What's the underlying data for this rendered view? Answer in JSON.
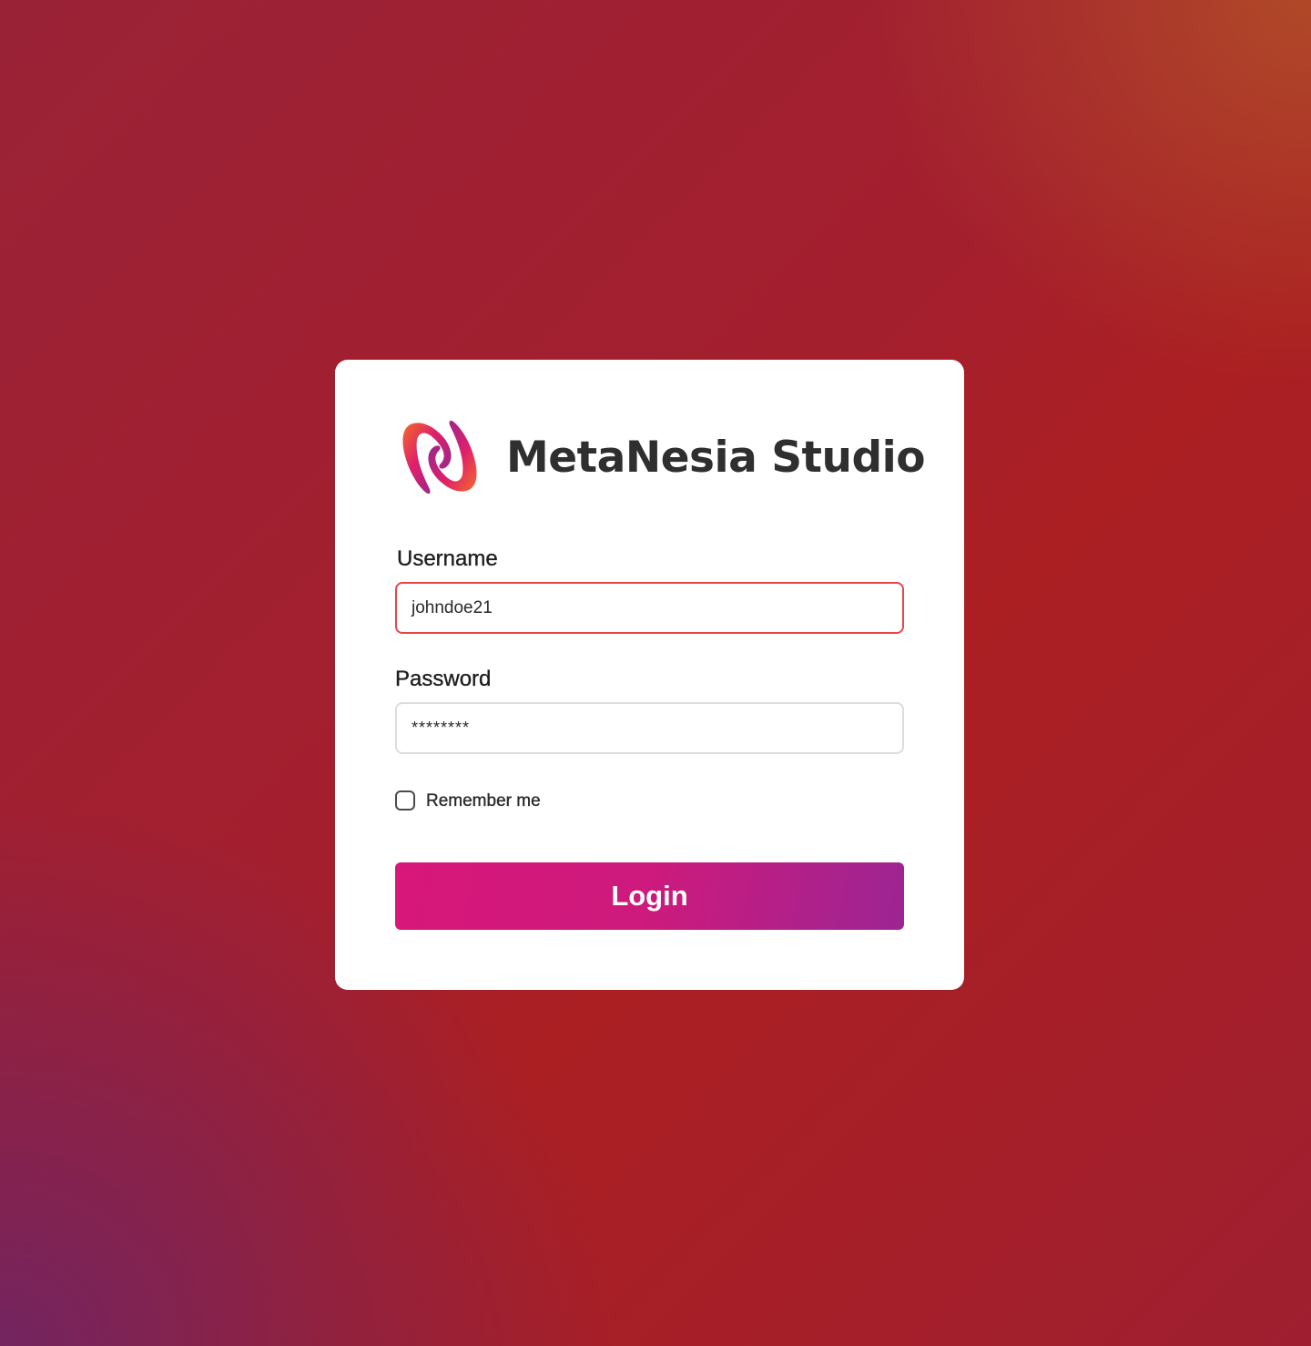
{
  "brand": {
    "name": "MetaNesia Studio",
    "logo_icon": "metanesia-n-logo-icon"
  },
  "form": {
    "username": {
      "label": "Username",
      "value": "johndoe21"
    },
    "password": {
      "label": "Password",
      "value": "********"
    },
    "remember": {
      "label": "Remember me",
      "checked": false
    },
    "submit_label": "Login"
  },
  "colors": {
    "accent_start": "#d8177a",
    "accent_end": "#9c2593",
    "error_border": "#e8454a",
    "background_red": "#ab1f22",
    "background_purple": "#732460"
  }
}
